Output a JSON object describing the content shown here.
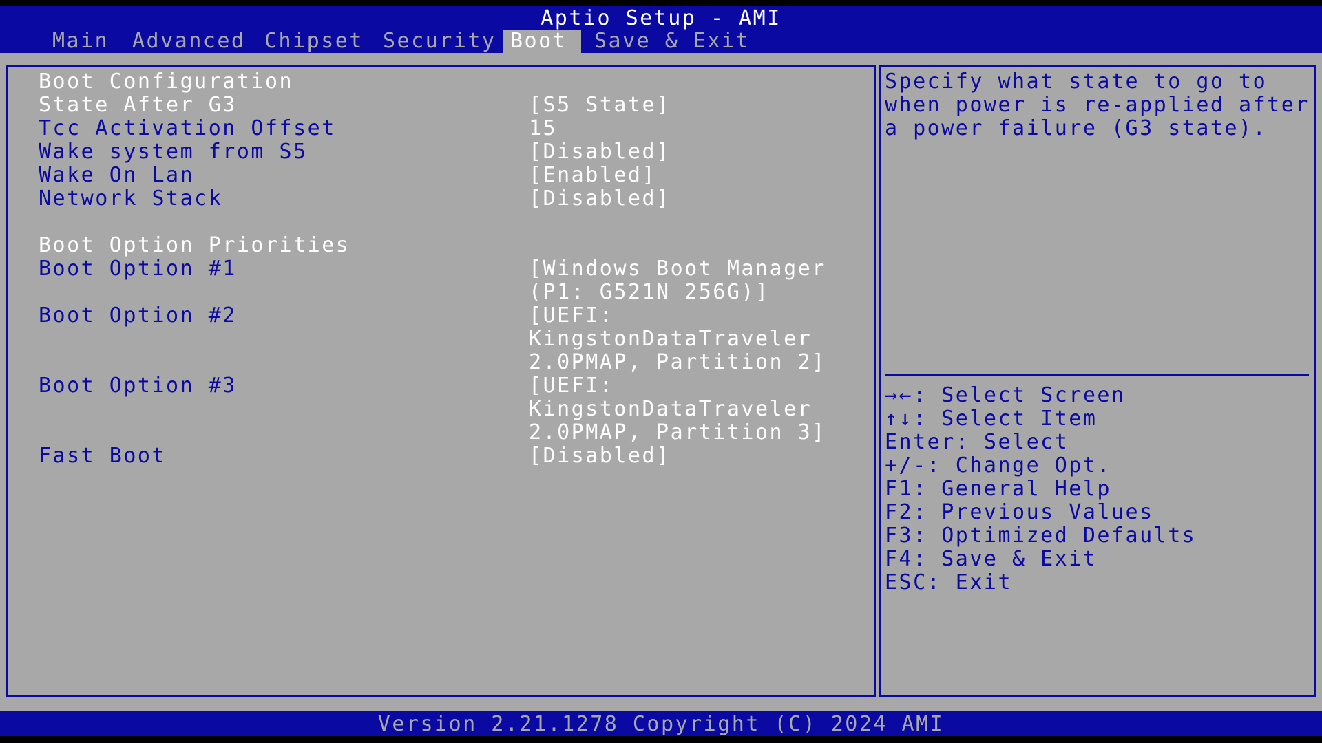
{
  "app_title": "Aptio Setup - AMI",
  "tabs": [
    {
      "label": "Main"
    },
    {
      "label": "Advanced"
    },
    {
      "label": "Chipset"
    },
    {
      "label": "Security"
    },
    {
      "label": "Boot"
    },
    {
      "label": "Save & Exit"
    }
  ],
  "active_tab": "Boot",
  "main": {
    "section_boot_config": "Boot Configuration",
    "state_after_g3": {
      "label": "State After G3",
      "value": "[S5 State]"
    },
    "tcc_offset": {
      "label": "Tcc Activation Offset",
      "value": "15"
    },
    "wake_s5": {
      "label": "Wake system from S5",
      "value": "[Disabled]"
    },
    "wake_lan": {
      "label": "Wake On Lan",
      "value": "[Enabled]"
    },
    "network_stack": {
      "label": "Network Stack",
      "value": "[Disabled]"
    },
    "section_priorities": "Boot Option Priorities",
    "boot_option_1": {
      "label": "Boot Option #1",
      "value_lines": [
        "[Windows Boot Manager",
        "(P1: G521N 256G)]"
      ]
    },
    "boot_option_2": {
      "label": "Boot Option #2",
      "value_lines": [
        "[UEFI:",
        "KingstonDataTraveler",
        "2.0PMAP, Partition 2]"
      ]
    },
    "boot_option_3": {
      "label": "Boot Option #3",
      "value_lines": [
        "[UEFI:",
        "KingstonDataTraveler",
        "2.0PMAP, Partition 3]"
      ]
    },
    "fast_boot": {
      "label": "Fast Boot",
      "value": "[Disabled]"
    }
  },
  "help": {
    "lines": [
      "Specify what state to go to",
      "when power is re-applied after",
      "a power failure (G3 state)."
    ]
  },
  "keys": [
    "→←: Select Screen",
    "↑↓: Select Item",
    "Enter: Select",
    "+/-: Change Opt.",
    "F1: General Help",
    "F2: Previous Values",
    "F3: Optimized Defaults",
    "F4: Save & Exit",
    "ESC: Exit"
  ],
  "footer": "Version 2.21.1278 Copyright (C) 2024 AMI",
  "colors": {
    "bios_blue": "#0a0aa3",
    "bios_gray": "#a8a8a8",
    "text_white": "#ffffff"
  }
}
